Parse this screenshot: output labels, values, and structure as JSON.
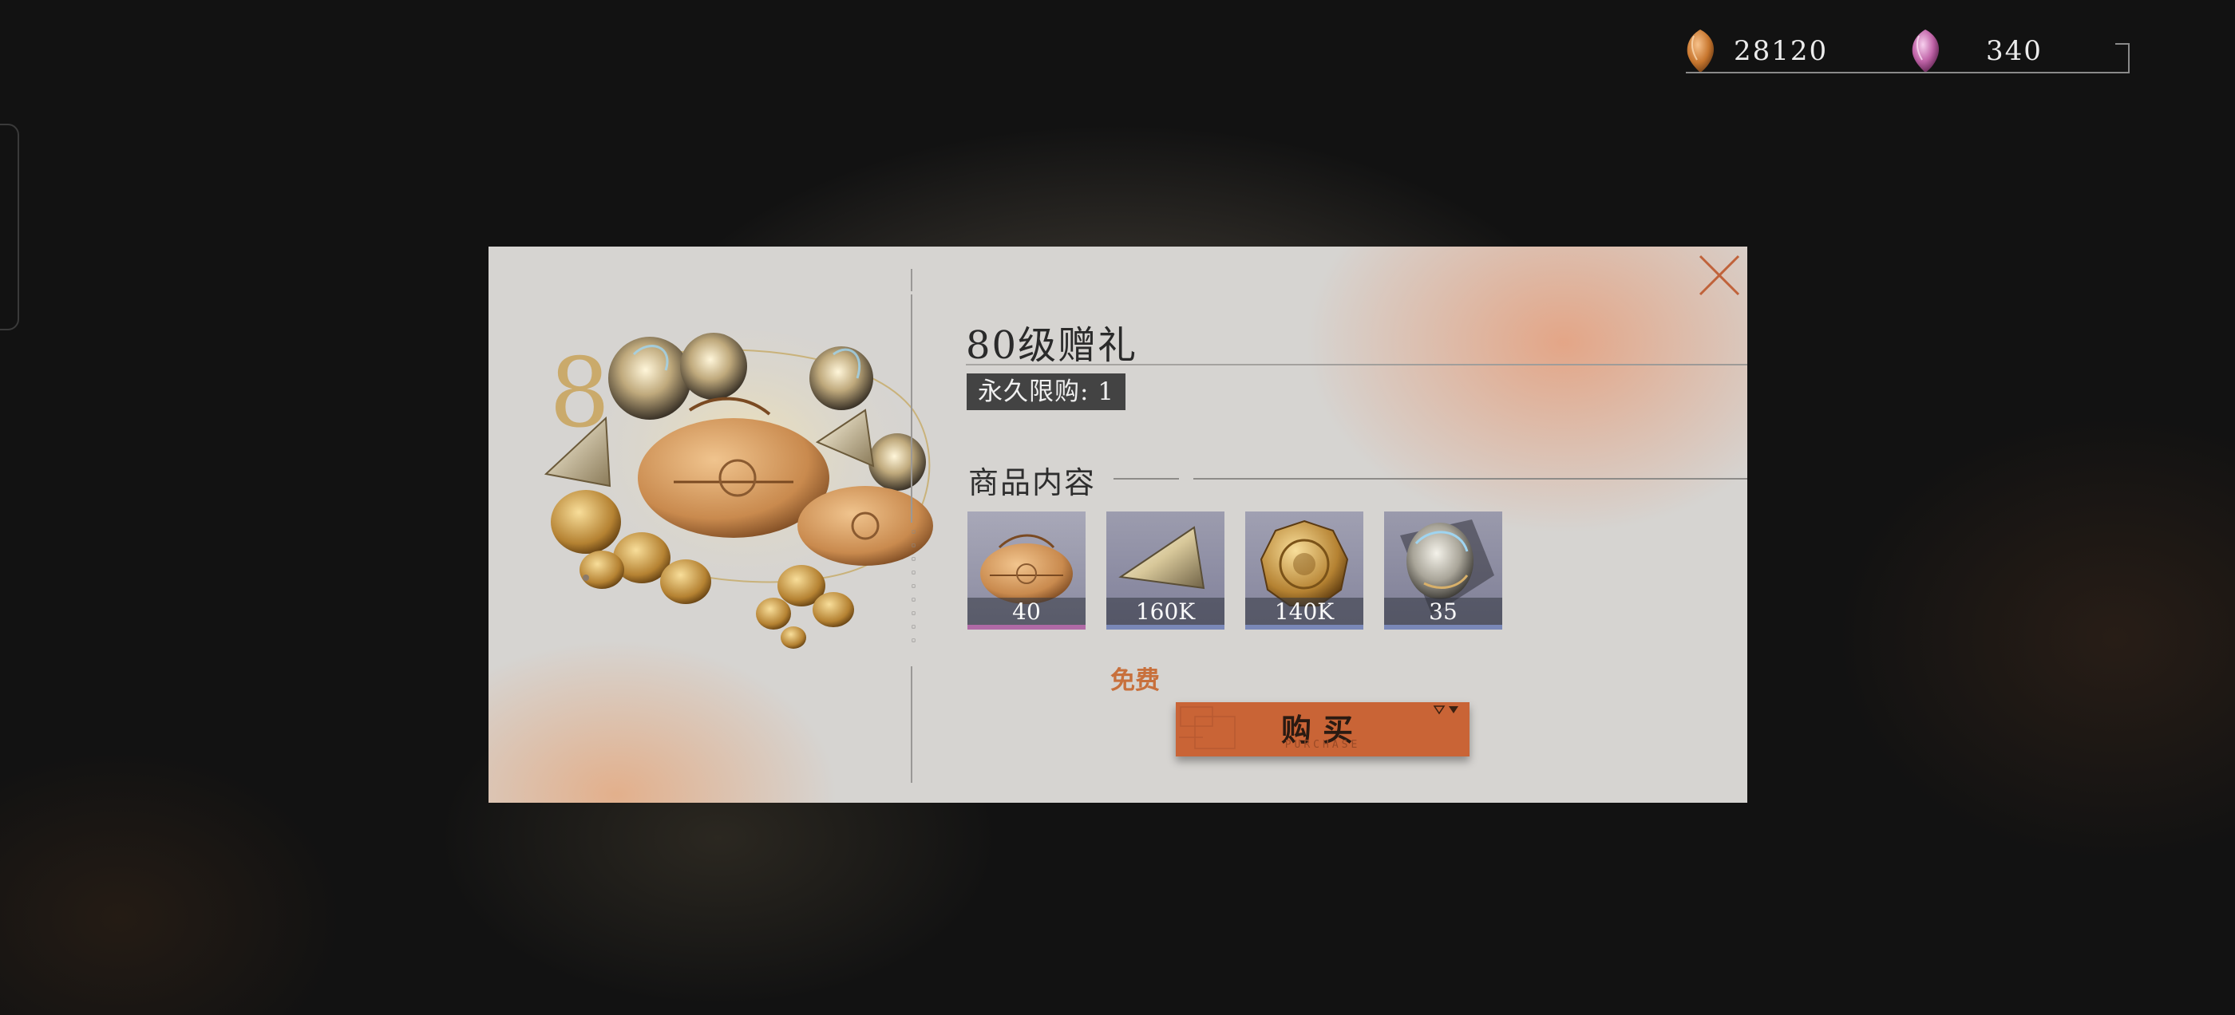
{
  "currency": {
    "gold": {
      "value": "28120",
      "icon": "amber-gem-icon"
    },
    "premium": {
      "value": "340",
      "icon": "pink-crystal-icon"
    }
  },
  "modal": {
    "title": "80级赠礼",
    "purchase_limit": "永久限购: 1",
    "section_title": "商品内容",
    "hero_image": "gift-pack-illustration",
    "items": [
      {
        "qty": "40",
        "icon": "cloth-bundle-icon",
        "rarity_color": "#b06aa6"
      },
      {
        "qty": "160K",
        "icon": "crystal-shard-icon",
        "rarity_color": "#7a88b8"
      },
      {
        "qty": "140K",
        "icon": "gold-coin-icon",
        "rarity_color": "#7a88b8"
      },
      {
        "qty": "35",
        "icon": "silver-shell-icon",
        "rarity_color": "#7a88b8"
      }
    ],
    "price_label": "免费",
    "buy_button": {
      "label": "购买",
      "sub_label": "PURCHASE"
    },
    "accent_color": "#c96436"
  }
}
